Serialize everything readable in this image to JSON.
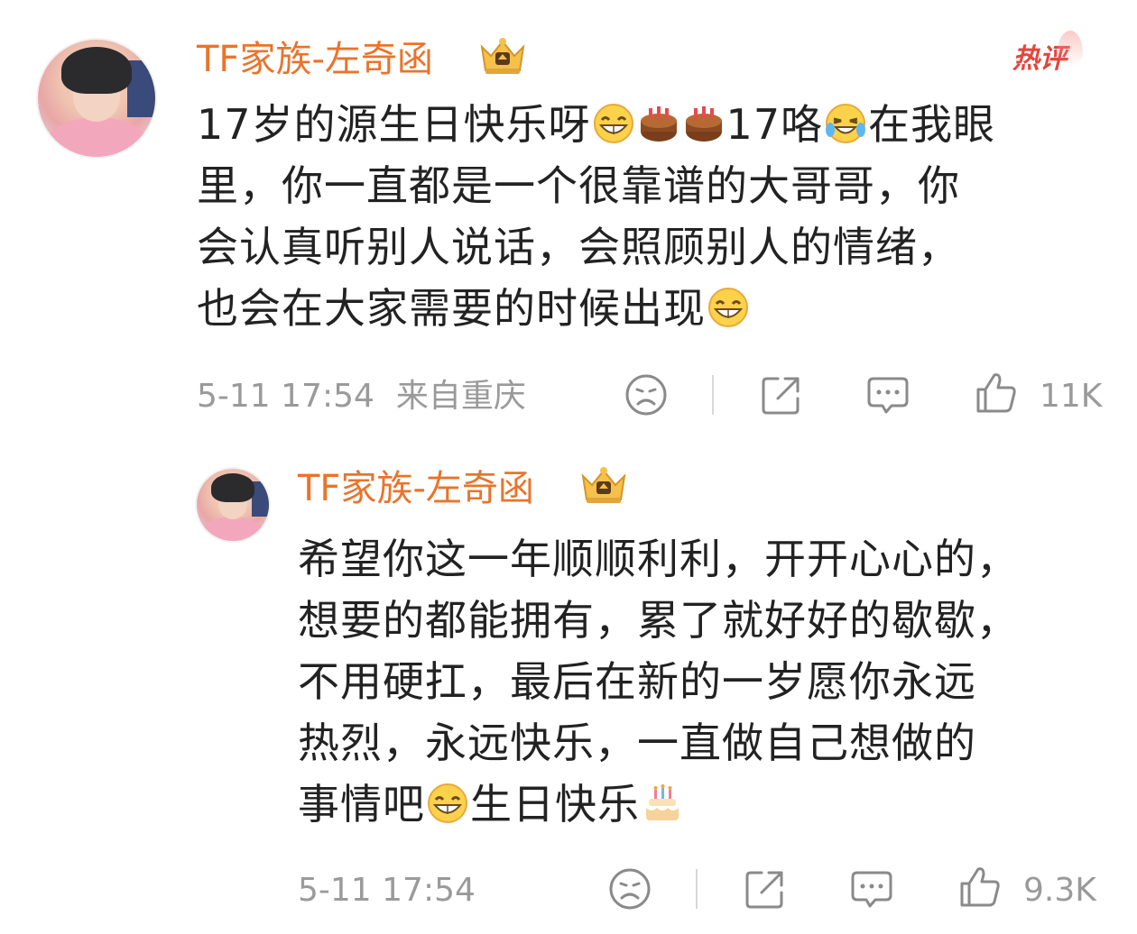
{
  "comment": {
    "author": "TF家族-左奇函",
    "badge": "热评",
    "lines": [
      [
        "17岁的源生日快乐呀",
        "grin-emoji",
        "cake-emoji",
        "cake-emoji",
        "17咯",
        "laugh-cry-emoji",
        "在我眼"
      ],
      [
        "里，你一直都是一个很靠谱的大哥哥，你"
      ],
      [
        "会认真听别人说话，会照顾别人的情绪，"
      ],
      [
        "也会在大家需要的时候出现",
        "grin-emoji"
      ]
    ],
    "time": "5-11 17:54",
    "location": "来自重庆",
    "like_count": "11K"
  },
  "reply": {
    "author": "TF家族-左奇函",
    "lines": [
      [
        "希望你这一年顺顺利利，开开心心的，"
      ],
      [
        "想要的都能拥有，累了就好好的歇歇，"
      ],
      [
        "不用硬扛，最后在新的一岁愿你永远"
      ],
      [
        "热烈，永远快乐，一直做自己想做的"
      ],
      [
        "事情吧",
        "grin-emoji",
        "生日快乐",
        "birthday-cake-emoji"
      ]
    ],
    "time": "5-11 17:54",
    "like_count": "9.3K"
  },
  "colors": {
    "author": "#e8742c",
    "hot_badge": "#e4453d",
    "text": "#222222",
    "meta": "#9a9a9a",
    "icon": "#8a8a8a"
  },
  "icons": {
    "dislike": "sad-face-icon",
    "share": "share-icon",
    "reply": "comment-bubble-icon",
    "like": "thumbs-up-icon",
    "vip": "crown-badge-icon"
  }
}
